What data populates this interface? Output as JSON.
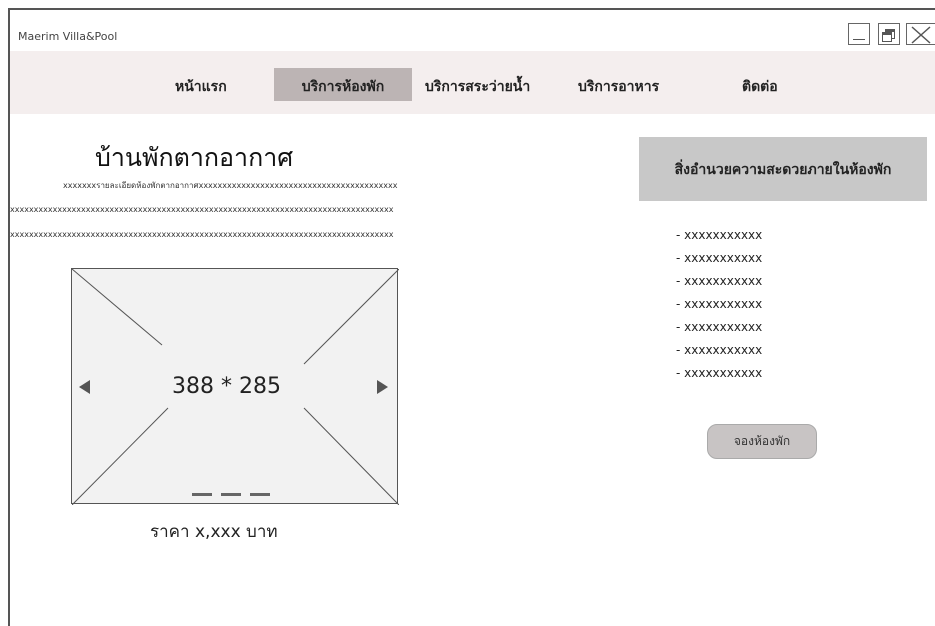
{
  "app": {
    "title": "Maerim Villa&Pool"
  },
  "nav": {
    "items": [
      {
        "label": "หน้าแรก"
      },
      {
        "label": "บริการห้องพัก"
      },
      {
        "label": "บริการสระว่ายน้ำ"
      },
      {
        "label": "บริการอาหาร"
      },
      {
        "label": "ติดต่อ"
      }
    ]
  },
  "room": {
    "title": "บ้านพักตากอากาศ",
    "desc_lines": [
      "xxxxxxxรายละเอียดห้องพักตากอากาศxxxxxxxxxxxxxxxxxxxxxxxxxxxxxxxxxxxxxxxxxx",
      "xxxxxxxxxxxxxxxxxxxxxxxxxxxxxxxxxxxxxxxxxxxxxxxxxxxxxxxxxxxxxxxxxxxxxxxxxxxxxxxxx",
      "xxxxxxxxxxxxxxxxxxxxxxxxxxxxxxxxxxxxxxxxxxxxxxxxxxxxxxxxxxxxxxxxxxxxxxxxxxxxxxxxx"
    ],
    "image_placeholder": "388 * 285",
    "price": "ราคา x,xxx บาท"
  },
  "amenities": {
    "title": "สิ่งอำนวยความสะดวยภายในห้องพัก",
    "items": [
      "- xxxxxxxxxxx",
      "- xxxxxxxxxxx",
      "- xxxxxxxxxxx",
      "- xxxxxxxxxxx",
      "- xxxxxxxxxxx",
      "- xxxxxxxxxxx",
      "- xxxxxxxxxxx"
    ]
  },
  "booking": {
    "button_label": "จองห้องพัก"
  },
  "colors": {
    "navbar_bg": "#f4eeee",
    "nav_active_bg": "#bcb4b4",
    "amenity_header_bg": "#c8c8c8",
    "button_bg": "#c8c4c4"
  }
}
